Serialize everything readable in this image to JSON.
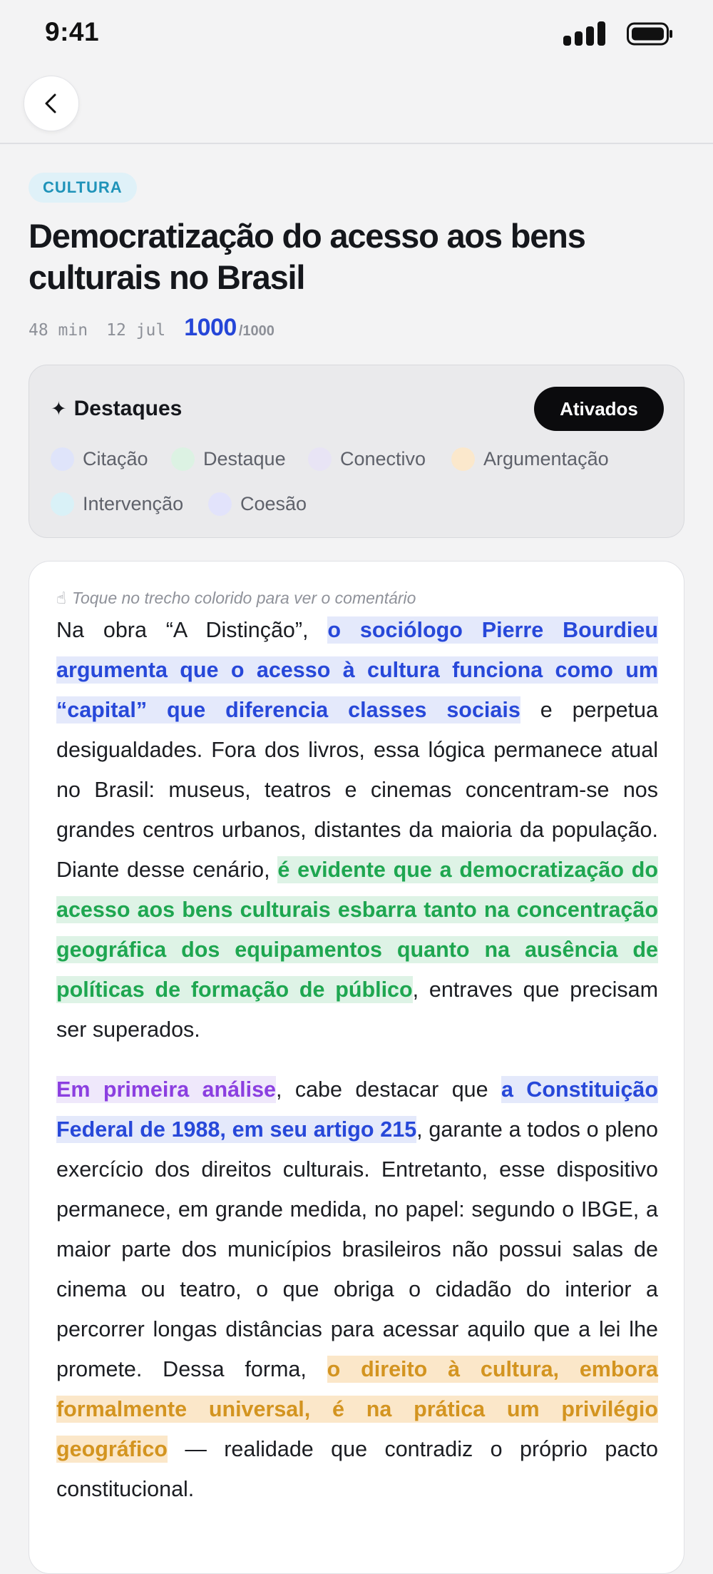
{
  "status_bar": {
    "time": "9:41"
  },
  "category": "CULTURA",
  "title": "Democratização do acesso aos bens culturais no Brasil",
  "meta": {
    "duration": "48 min",
    "date": "12 jul",
    "score": "1000",
    "score_total": "/1000"
  },
  "highlights": {
    "title": "Destaques",
    "toggle_label": "Ativados",
    "legend": [
      {
        "label": "Citação",
        "color": "#dfe4fa"
      },
      {
        "label": "Destaque",
        "color": "#dcf2e3"
      },
      {
        "label": "Conectivo",
        "color": "#e8e4f5"
      },
      {
        "label": "Argumentação",
        "color": "#fbe8cc"
      },
      {
        "label": "Intervenção",
        "color": "#d9f1f7"
      },
      {
        "label": "Coesão",
        "color": "#e2e3fb"
      }
    ]
  },
  "essay": {
    "hint": "Toque no trecho colorido para ver o comentário",
    "p1": {
      "t1": "Na obra “A Distinção”, ",
      "h1": "o sociólogo Pierre Bourdieu argumenta que o acesso à cultura funciona como um “capital” que diferencia classes sociais",
      "t2": " e perpetua desigualdades. Fora dos livros, essa lógica permanece atual no Brasil: museus, teatros e cinemas concentram-se nos grandes centros urbanos, distantes da maioria da população. Diante desse cenário, ",
      "h2": "é evidente que a democratização do acesso aos bens culturais esbarra tanto na concentração geográfica dos equipamentos quanto na ausência de políticas de formação de público",
      "t3": ", entraves que precisam ser superados."
    },
    "p2": {
      "h1": "Em primeira análise",
      "t1": ", cabe destacar que ",
      "h2": "a Constituição Federal de 1988, em seu artigo 215",
      "t2": ", garante a todos o pleno exercício dos direitos culturais. Entretanto, esse dispositivo permanece, em grande medida, no papel: segundo o IBGE, a maior parte dos municípios brasileiros não possui salas de cinema ou teatro, o que obriga o cidadão do interior a percorrer longas distâncias para acessar aquilo que a lei lhe promete. Dessa forma, ",
      "h3": "o direito à cultura, embora formalmente universal, é na prática um privilégio geográfico",
      "t3": " — realidade que contradiz o próprio pacto constitucional."
    }
  }
}
